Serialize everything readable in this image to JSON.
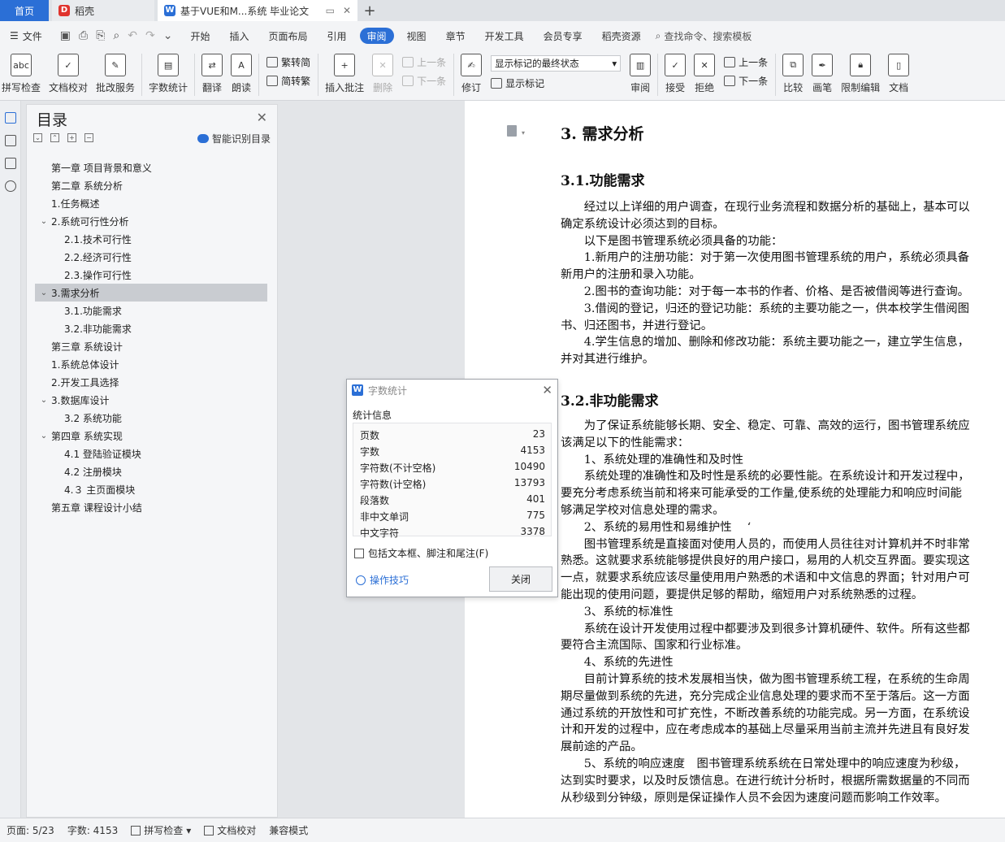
{
  "tabs": {
    "home": "首页",
    "daoke": "稻壳",
    "doc": "基于VUE和M...系统 毕业论文",
    "add": "+"
  },
  "menu": {
    "file": "文件",
    "items": [
      "开始",
      "插入",
      "页面布局",
      "引用",
      "审阅",
      "视图",
      "章节",
      "开发工具",
      "会员专享",
      "稻壳资源"
    ],
    "active": "审阅",
    "search": "查找命令、搜索模板"
  },
  "ribbon": {
    "spell": "拼写检查",
    "proof": "文档校对",
    "batch": "批改服务",
    "wordcount": "字数统计",
    "translate": "翻译",
    "read": "朗读",
    "trad": "繁转简",
    "simp": "简转繁",
    "insert_comment": "插入批注",
    "delete": "删除",
    "prev_comment": "上一条",
    "next_comment": "下一条",
    "revise": "修订",
    "markup_select": "显示标记的最终状态",
    "show_markup": "显示标记",
    "review": "审阅",
    "accept": "接受",
    "reject": "拒绝",
    "prev_change": "上一条",
    "next_change": "下一条",
    "compare": "比较",
    "pen": "画笔",
    "restrict": "限制编辑",
    "doc_more": "文档"
  },
  "toc": {
    "title": "目录",
    "smart": "智能识别目录",
    "items": [
      {
        "label": "第一章  项目背景和意义",
        "level": 1,
        "arrow": ""
      },
      {
        "label": "第二章  系统分析",
        "level": 1,
        "arrow": ""
      },
      {
        "label": "1.任务概述",
        "level": 1,
        "arrow": ""
      },
      {
        "label": "2.系统可行性分析",
        "level": 1,
        "arrow": "⌄"
      },
      {
        "label": "2.1.技术可行性",
        "level": 2,
        "arrow": ""
      },
      {
        "label": "2.2.经济可行性",
        "level": 2,
        "arrow": ""
      },
      {
        "label": "2.3.操作可行性",
        "level": 2,
        "arrow": ""
      },
      {
        "label": "3.需求分析",
        "level": 1,
        "arrow": "⌄",
        "selected": true
      },
      {
        "label": "3.1.功能需求",
        "level": 2,
        "arrow": ""
      },
      {
        "label": "3.2.非功能需求",
        "level": 2,
        "arrow": ""
      },
      {
        "label": "第三章  系统设计",
        "level": 1,
        "arrow": ""
      },
      {
        "label": "1.系统总体设计",
        "level": 1,
        "arrow": ""
      },
      {
        "label": "2.开发工具选择",
        "level": 1,
        "arrow": ""
      },
      {
        "label": "3.数据库设计",
        "level": 1,
        "arrow": "⌄"
      },
      {
        "label": "3.2  系统功能",
        "level": 2,
        "arrow": ""
      },
      {
        "label": "第四章  系统实现",
        "level": 1,
        "arrow": "⌄"
      },
      {
        "label": "4.1  登陆验证模块",
        "level": 2,
        "arrow": ""
      },
      {
        "label": "4.2  注册模块",
        "level": 2,
        "arrow": ""
      },
      {
        "label": "4.３  主页面模块",
        "level": 2,
        "arrow": ""
      },
      {
        "label": "第五章  课程设计小结",
        "level": 1,
        "arrow": ""
      }
    ]
  },
  "document": {
    "h1": "3.  需求分析",
    "h2a": "3.1.功能需求",
    "h2b": "3.2.非功能需求",
    "lines_a": [
      "　　经过以上详细的用户调查，在现行业务流程和数据分析的基础上，基本可以",
      "确定系统设计必须达到的目标。",
      "　　以下是图书管理系统必须具备的功能：",
      "　　1.新用户的注册功能：对于第一次使用图书管理系统的用户，系统必须具备",
      "新用户的注册和录入功能。",
      "　　2.图书的查询功能：对于每一本书的作者、价格、是否被借阅等进行查询。",
      "　　3.借阅的登记，归还的登记功能：系统的主要功能之一，供本校学生借阅图",
      "书、归还图书，并进行登记。",
      "　　4.学生信息的增加、删除和修改功能：系统主要功能之一，建立学生信息，",
      "并对其进行维护。"
    ],
    "lines_b": [
      "　　为了保证系统能够长期、安全、稳定、可靠、高效的运行，图书管理系统应",
      "该满足以下的性能需求：",
      "　　1、系统处理的准确性和及时性",
      "　　系统处理的准确性和及时性是系统的必要性能。在系统设计和开发过程中，",
      "要充分考虑系统当前和将来可能承受的工作量,使系统的处理能力和响应时间能",
      "够满足学校对信息处理的需求。",
      "　　2、系统的易用性和易维护性　 ‘",
      "　　图书管理系统是直接面对使用人员的，而使用人员往往对计算机并不时非常",
      "熟悉。这就要求系统能够提供良好的用户接口，易用的人机交互界面。要实现这",
      "一点，就要求系统应该尽量使用用户熟悉的术语和中文信息的界面；针对用户可",
      "能出现的使用问题，要提供足够的帮助，缩短用户对系统熟悉的过程。",
      "　　3、系统的标准性",
      "　　系统在设计开发使用过程中都要涉及到很多计算机硬件、软件。所有这些都",
      "要符合主流国际、国家和行业标准。",
      "　　4、系统的先进性",
      "　　目前计算系统的技术发展相当快，做为图书管理系统工程，在系统的生命周",
      "期尽量做到系统的先进，充分完成企业信息处理的要求而不至于落后。这一方面",
      "通过系统的开放性和可扩充性，不断改善系统的功能完成。另一方面，在系统设",
      "计和开发的过程中，应在考虑成本的基础上尽量采用当前主流并先进且有良好发",
      "展前途的产品。",
      "　　5、系统的响应速度　图书管理系统系统在日常处理中的响应速度为秒级，",
      "达到实时要求，以及时反馈信息。在进行统计分析时，根据所需数据量的不同而",
      "从秒级到分钟级，原则是保证操作人员不会因为速度问题而影响工作效率。"
    ]
  },
  "dialog": {
    "title": "字数统计",
    "section": "统计信息",
    "rows": [
      {
        "label": "页数",
        "value": "23"
      },
      {
        "label": "字数",
        "value": "4153"
      },
      {
        "label": "字符数(不计空格)",
        "value": "10490"
      },
      {
        "label": "字符数(计空格)",
        "value": "13793"
      },
      {
        "label": "段落数",
        "value": "401"
      },
      {
        "label": "非中文单词",
        "value": "775"
      },
      {
        "label": "中文字符",
        "value": "3378"
      }
    ],
    "checkbox": "包括文本框、脚注和尾注(F)",
    "tips": "操作技巧",
    "close": "关闭"
  },
  "status": {
    "page": "页面: 5/23",
    "words": "字数: 4153",
    "spell": "拼写检查",
    "proof": "文档校对",
    "compat": "兼容模式"
  }
}
